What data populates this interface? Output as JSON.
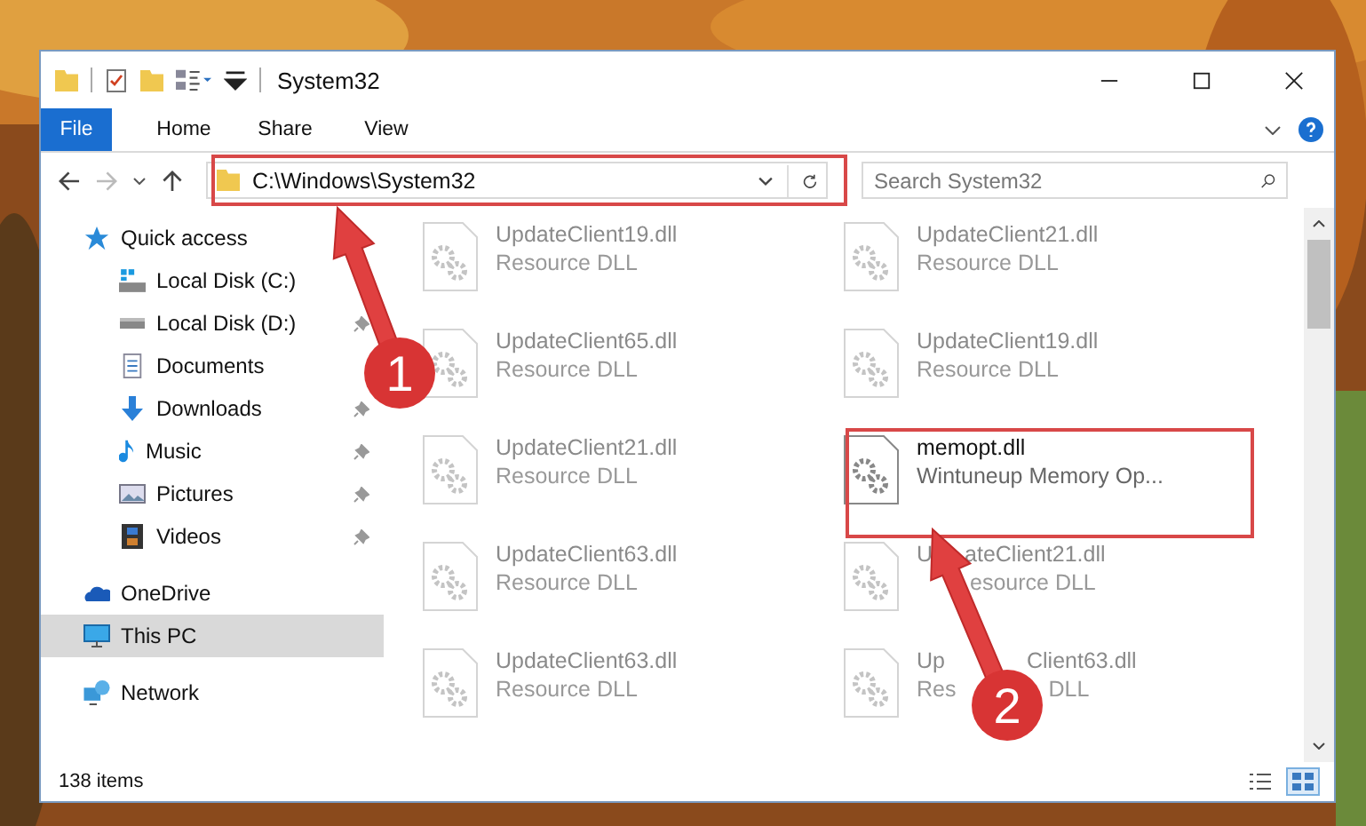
{
  "window": {
    "title": "System32"
  },
  "ribbon_tabs": [
    {
      "label": "File",
      "selected": true
    },
    {
      "label": "Home",
      "selected": false
    },
    {
      "label": "Share",
      "selected": false
    },
    {
      "label": "View",
      "selected": false
    }
  ],
  "address_bar": {
    "path": "C:\\Windows\\System32"
  },
  "search": {
    "placeholder": "Search System32"
  },
  "sidebar": {
    "items": [
      {
        "label": "Quick access",
        "kind": "star",
        "pinned": false,
        "selected": false
      },
      {
        "label": "Local Disk (C:)",
        "kind": "drive-win",
        "pinned": false,
        "selected": false
      },
      {
        "label": "Local Disk (D:)",
        "kind": "drive",
        "pinned": true,
        "selected": false
      },
      {
        "label": "Documents",
        "kind": "docs",
        "pinned": false,
        "selected": false
      },
      {
        "label": "Downloads",
        "kind": "download",
        "pinned": true,
        "selected": false
      },
      {
        "label": "Music",
        "kind": "music",
        "pinned": true,
        "selected": false
      },
      {
        "label": "Pictures",
        "kind": "pictures",
        "pinned": true,
        "selected": false
      },
      {
        "label": "Videos",
        "kind": "videos",
        "pinned": true,
        "selected": false
      },
      {
        "label": "OneDrive",
        "kind": "cloud",
        "pinned": false,
        "selected": false
      },
      {
        "label": "This PC",
        "kind": "pc",
        "pinned": false,
        "selected": true
      },
      {
        "label": "Network",
        "kind": "network",
        "pinned": false,
        "selected": false
      }
    ]
  },
  "files": [
    {
      "name": [
        "UpdateClient19.dll"
      ],
      "type": [
        "Resource DLL"
      ],
      "blurred": true
    },
    {
      "name": [
        "UpdateClient21.dll"
      ],
      "type": [
        "Resource DLL"
      ],
      "blurred": true
    },
    {
      "name": [
        "UpdateClient65.dll"
      ],
      "type": [
        "Resource DLL"
      ],
      "blurred": true
    },
    {
      "name": [
        "UpdateClient19.dll"
      ],
      "type": [
        "Resource DLL"
      ],
      "blurred": true
    },
    {
      "name": [
        "UpdateClient21.dll"
      ],
      "type": [
        "Resource DLL"
      ],
      "blurred": true
    },
    {
      "name": [
        "memopt.dll"
      ],
      "type": [
        "Wintuneup Memory Op..."
      ],
      "blurred": false
    },
    {
      "name": [
        "UpdateClient63.dll"
      ],
      "type": [
        "Resource DLL"
      ],
      "blurred": true
    },
    {
      "name": [
        "U",
        "ateClient21.dll"
      ],
      "type": [
        "esource DLL"
      ],
      "blurred": true
    },
    {
      "name": [
        "UpdateClient63.dll"
      ],
      "type": [
        "Resource DLL"
      ],
      "blurred": true
    },
    {
      "name": [
        "Up",
        "Client63.dll"
      ],
      "type": [
        "Res",
        "DLL"
      ],
      "blurred": true
    }
  ],
  "status_bar": {
    "item_count": "138 items"
  },
  "annotations": [
    {
      "number": "1"
    },
    {
      "number": "2"
    }
  ]
}
